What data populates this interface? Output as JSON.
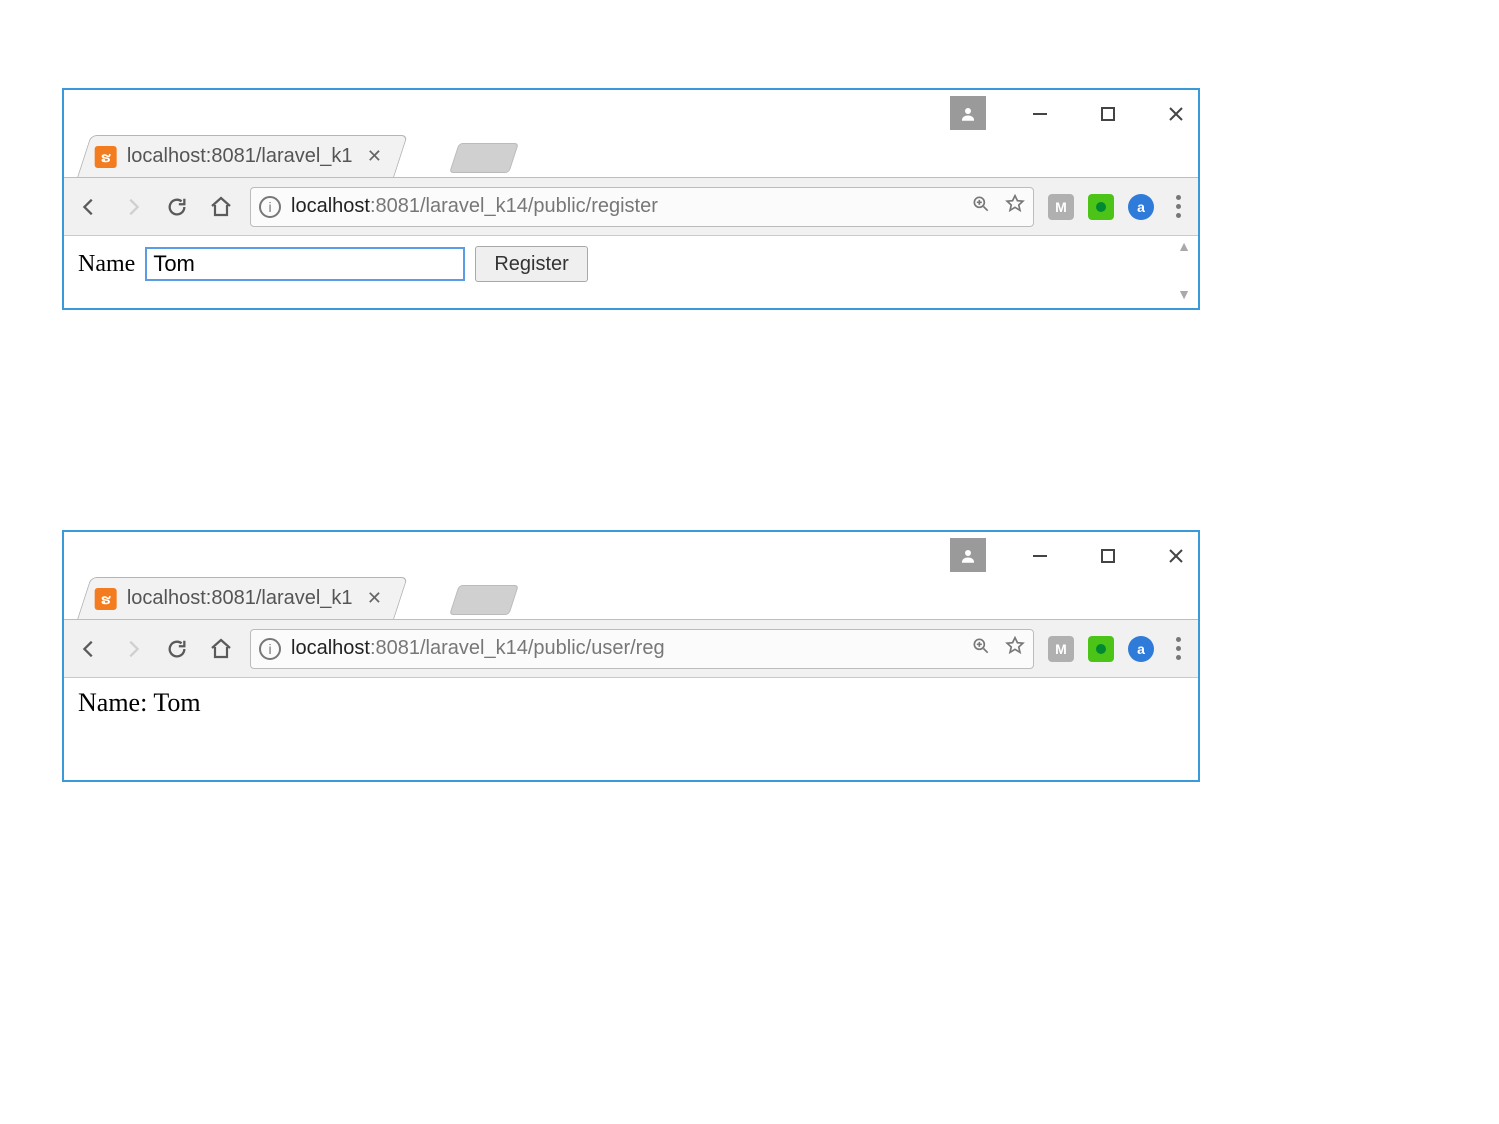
{
  "window1": {
    "tab_title": "localhost:8081/laravel_k1",
    "url_host": "localhost",
    "url_path": ":8081/laravel_k14/public/register",
    "form": {
      "name_label": "Name",
      "name_value": "Tom",
      "submit_label": "Register"
    }
  },
  "window2": {
    "tab_title": "localhost:8081/laravel_k1",
    "url_host": "localhost",
    "url_path": ":8081/laravel_k14/public/user/reg",
    "result_text": "Name: Tom"
  },
  "ext_labels": {
    "m": "M",
    "q": "",
    "a": "a"
  }
}
